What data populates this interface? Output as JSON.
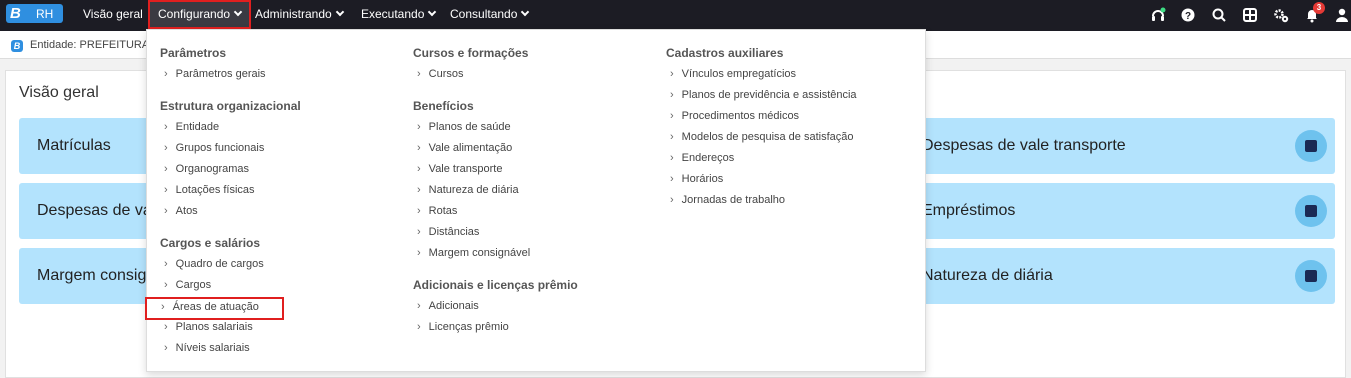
{
  "app": {
    "logo_letter": "B",
    "logo_label": "RH"
  },
  "nav": [
    {
      "label": "Visão geral"
    },
    {
      "label": "Configurando"
    },
    {
      "label": "Administrando"
    },
    {
      "label": "Executando"
    },
    {
      "label": "Consultando"
    }
  ],
  "notifications": {
    "count": "3"
  },
  "icons": [
    "headset-icon",
    "help-icon",
    "search-icon",
    "apps-icon",
    "settings-icon",
    "bell-icon",
    "user-icon"
  ],
  "entity": {
    "icon_letter": "B",
    "label": "Entidade: PREFEITURA D"
  },
  "main": {
    "title": "Visão geral",
    "cards": [
      {
        "label": "Matrículas",
        "icon": "id-icon"
      },
      {
        "label": "Despesas de vale transporte",
        "icon": "bus-icon"
      },
      {
        "label": "Despesas de vale",
        "icon": ""
      },
      {
        "label": "Empréstimos",
        "icon": "money-icon"
      },
      {
        "label": "Margem consign",
        "icon": ""
      },
      {
        "label": "Natureza de diária",
        "icon": "building-icon"
      }
    ]
  },
  "menu": {
    "col1": {
      "s1": {
        "title": "Parâmetros",
        "items": [
          "Parâmetros gerais"
        ]
      },
      "s2": {
        "title": "Estrutura organizacional",
        "items": [
          "Entidade",
          "Grupos funcionais",
          "Organogramas",
          "Lotações físicas",
          "Atos"
        ]
      },
      "s3": {
        "title": "Cargos e salários",
        "items": [
          "Quadro de cargos",
          "Cargos",
          "Áreas de atuação",
          "Planos salariais",
          "Níveis salariais"
        ]
      }
    },
    "col2": {
      "s1": {
        "title": "Cursos e formações",
        "items": [
          "Cursos"
        ]
      },
      "s2": {
        "title": "Benefícios",
        "items": [
          "Planos de saúde",
          "Vale alimentação",
          "Vale transporte",
          "Natureza de diária",
          "Rotas",
          "Distâncias",
          "Margem consignável"
        ]
      },
      "s3": {
        "title": "Adicionais e licenças prêmio",
        "items": [
          "Adicionais",
          "Licenças prêmio"
        ]
      }
    },
    "col3": {
      "s1": {
        "title": "Cadastros auxiliares",
        "items": [
          "Vínculos empregatícios",
          "Planos de previdência e assistência",
          "Procedimentos médicos",
          "Modelos de pesquisa de satisfação",
          "Endereços",
          "Horários",
          "Jornadas de trabalho"
        ]
      }
    }
  }
}
